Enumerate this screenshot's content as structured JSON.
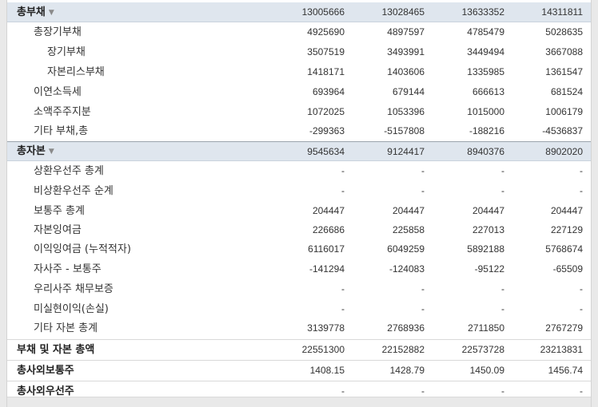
{
  "rows": {
    "total_liabilities": {
      "label": "총부채",
      "values": [
        "13005666",
        "13028465",
        "13633352",
        "14311811"
      ]
    },
    "total_long_term_debt": {
      "label": "총장기부채",
      "values": [
        "4925690",
        "4897597",
        "4785479",
        "5028635"
      ]
    },
    "long_term_debt": {
      "label": "장기부채",
      "values": [
        "3507519",
        "3493991",
        "3449494",
        "3667088"
      ]
    },
    "capital_lease_obligations": {
      "label": "자본리스부채",
      "values": [
        "1418171",
        "1403606",
        "1335985",
        "1361547"
      ]
    },
    "deferred_income_tax": {
      "label": "이연소득세",
      "values": [
        "693964",
        "679144",
        "666613",
        "681524"
      ]
    },
    "minority_interest": {
      "label": "소액주주지분",
      "values": [
        "1072025",
        "1053396",
        "1015000",
        "1006179"
      ]
    },
    "other_liabilities": {
      "label": "기타 부채,총",
      "values": [
        "-299363",
        "-5157808",
        "-188216",
        "-4536837"
      ]
    },
    "total_equity": {
      "label": "총자본",
      "values": [
        "9545634",
        "9124417",
        "8940376",
        "8902020"
      ]
    },
    "redeemable_preferred": {
      "label": "상환우선주 총계",
      "values": [
        "-",
        "-",
        "-",
        "-"
      ]
    },
    "non_redeemable_preferred": {
      "label": "비상환우선주 순계",
      "values": [
        "-",
        "-",
        "-",
        "-"
      ]
    },
    "common_stock": {
      "label": "보통주 총계",
      "values": [
        "204447",
        "204447",
        "204447",
        "204447"
      ]
    },
    "additional_paid_in_capital": {
      "label": "자본잉여금",
      "values": [
        "226686",
        "225858",
        "227013",
        "227129"
      ]
    },
    "retained_earnings": {
      "label": "이익잉여금 (누적적자)",
      "values": [
        "6116017",
        "6049259",
        "5892188",
        "5768674"
      ]
    },
    "treasury_stock": {
      "label": "자사주 - 보통주",
      "values": [
        "-141294",
        "-124083",
        "-95122",
        "-65509"
      ]
    },
    "esop_debt_guarantee": {
      "label": "우리사주 채무보증",
      "values": [
        "-",
        "-",
        "-",
        "-"
      ]
    },
    "unrealized_gain_loss": {
      "label": "미실현이익(손실)",
      "values": [
        "-",
        "-",
        "-",
        "-"
      ]
    },
    "other_equity": {
      "label": "기타 자본 총계",
      "values": [
        "3139778",
        "2768936",
        "2711850",
        "2767279"
      ]
    },
    "total_liabilities_equity": {
      "label": "부채 및 자본 총액",
      "values": [
        "22551300",
        "22152882",
        "22573728",
        "23213831"
      ]
    },
    "shares_common": {
      "label": "총사외보통주",
      "values": [
        "1408.15",
        "1428.79",
        "1450.09",
        "1456.74"
      ]
    },
    "shares_preferred": {
      "label": "총사외우선주",
      "values": [
        "-",
        "-",
        "-",
        "-"
      ]
    }
  }
}
